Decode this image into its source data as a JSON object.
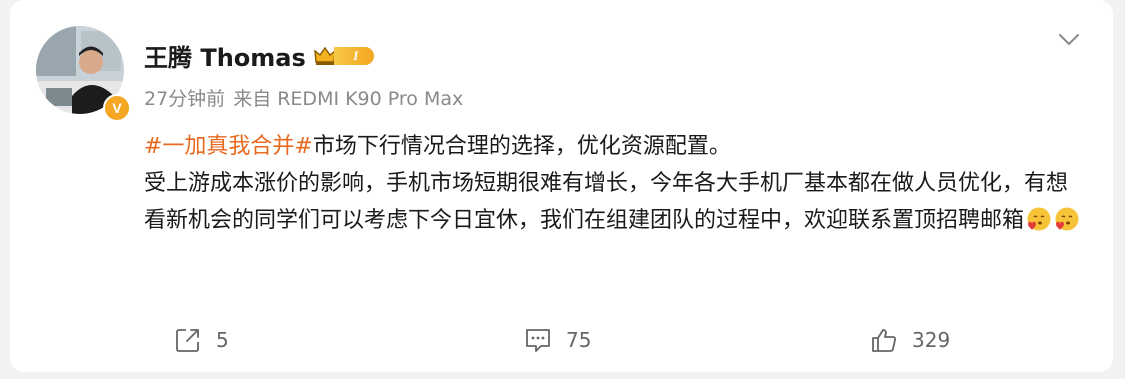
{
  "post": {
    "author": {
      "name": "王腾 Thomas",
      "level_badge": "I",
      "verified_badge": "V"
    },
    "meta": {
      "time": "27分钟前",
      "source": "来自 REDMI K90 Pro Max"
    },
    "content": {
      "topic": "#一加真我合并#",
      "line1_rest": "市场下行情况合理的选择，优化资源配置。",
      "line2": "受上游成本涨价的影响，手机市场短期很难有增长，今年各大手机厂基本都在做人员优化，有想看新机会的同学们可以考虑下今日宜休，我们在组建团队的过程中，欢迎联系置顶招聘邮箱",
      "emojis": [
        "hearts-face-emoji",
        "hearts-face-emoji"
      ]
    },
    "actions": {
      "share_count": "5",
      "comment_count": "75",
      "like_count": "329"
    }
  },
  "colors": {
    "topic": "#e86a1f",
    "badge": "#f5a623",
    "text": "#1a1a1a",
    "meta": "#8a8a8a"
  }
}
